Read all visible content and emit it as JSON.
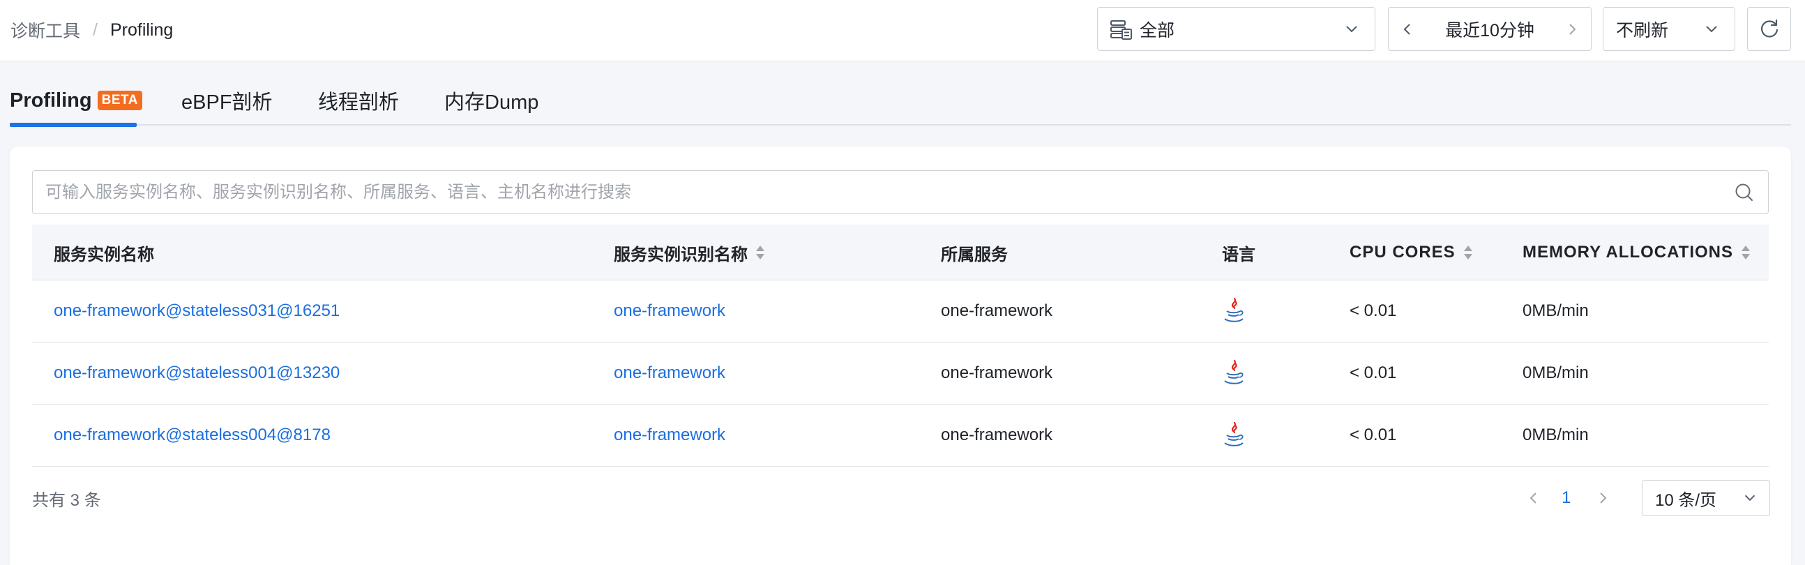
{
  "breadcrumb": {
    "parent": "诊断工具",
    "separator": "/",
    "current": "Profiling"
  },
  "header": {
    "scope_label": "全部",
    "time_range_label": "最近10分钟",
    "refresh_label": "不刷新"
  },
  "tabs": [
    {
      "label": "Profiling",
      "badge": "BETA",
      "active": true
    },
    {
      "label": "eBPF剖析",
      "active": false
    },
    {
      "label": "线程剖析",
      "active": false
    },
    {
      "label": "内存Dump",
      "active": false
    }
  ],
  "search": {
    "placeholder": "可输入服务实例名称、服务实例识别名称、所属服务、语言、主机名称进行搜索",
    "value": ""
  },
  "table": {
    "columns": [
      {
        "label": "服务实例名称",
        "sortable": false
      },
      {
        "label": "服务实例识别名称",
        "sortable": true
      },
      {
        "label": "所属服务",
        "sortable": false
      },
      {
        "label": "语言",
        "sortable": false
      },
      {
        "label": "CPU CORES",
        "sortable": true
      },
      {
        "label": "MEMORY ALLOCATIONS",
        "sortable": true
      }
    ],
    "rows": [
      {
        "instance_name": "one-framework@stateless031@16251",
        "instance_id_name": "one-framework",
        "service": "one-framework",
        "language_icon": "java-icon",
        "cpu_cores": "< 0.01",
        "memory_allocations": "0MB/min"
      },
      {
        "instance_name": "one-framework@stateless001@13230",
        "instance_id_name": "one-framework",
        "service": "one-framework",
        "language_icon": "java-icon",
        "cpu_cores": "< 0.01",
        "memory_allocations": "0MB/min"
      },
      {
        "instance_name": "one-framework@stateless004@8178",
        "instance_id_name": "one-framework",
        "service": "one-framework",
        "language_icon": "java-icon",
        "cpu_cores": "< 0.01",
        "memory_allocations": "0MB/min"
      }
    ]
  },
  "pagination": {
    "total_label": "共有 3 条",
    "current_page": "1",
    "page_size_label": "10 条/页"
  },
  "colors": {
    "accent": "#1a73e8",
    "link": "#1a6fe0",
    "beta_badge": "#f46d1f",
    "java_red": "#e1251b",
    "java_blue": "#2d6db5"
  }
}
